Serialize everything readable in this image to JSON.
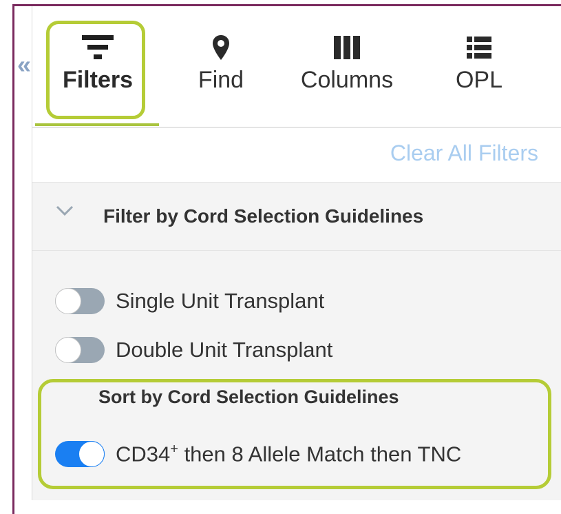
{
  "collapse": {
    "glyph": "«"
  },
  "tabs": [
    {
      "label": "Filters",
      "icon": "filter-icon",
      "active": true
    },
    {
      "label": "Find",
      "icon": "map-pin-icon",
      "active": false
    },
    {
      "label": "Columns",
      "icon": "columns-icon",
      "active": false
    },
    {
      "label": "OPL",
      "icon": "list-icon",
      "active": false
    }
  ],
  "clear_all": {
    "label": "Clear All Filters"
  },
  "filter_section": {
    "title": "Filter by Cord Selection Guidelines",
    "toggles": [
      {
        "label": "Single Unit Transplant",
        "on": false
      },
      {
        "label": "Double Unit Transplant",
        "on": false
      }
    ]
  },
  "sort_section": {
    "title": "Sort by Cord Selection Guidelines",
    "toggle": {
      "label_pre": "CD34",
      "label_sup": "+",
      "label_post": " then 8 Allele Match then TNC",
      "on": true
    }
  },
  "colors": {
    "accent_highlight": "#b5cc36",
    "toggle_on": "#1a7ff2",
    "toggle_off": "#9aa7b3",
    "link": "#a9cdf0",
    "frame_border": "#7a2a5e"
  }
}
